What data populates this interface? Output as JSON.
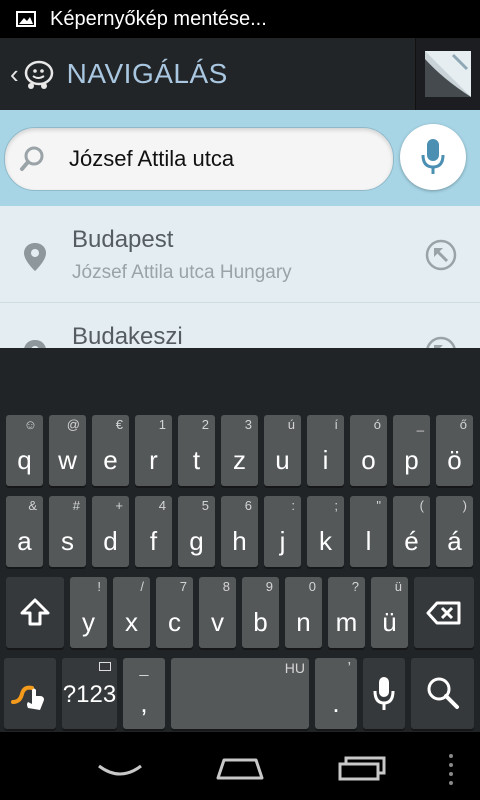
{
  "status_bar": {
    "text": "Képernyőkép mentése...",
    "icon": "screenshot-icon"
  },
  "action_bar": {
    "title": "NAVIGÁLÁS",
    "back_icon": "back-icon",
    "logo_icon": "waze-logo-icon",
    "menu_thumb": "map-thumbnail-icon"
  },
  "search": {
    "value": "József Attila utca",
    "icon": "search-icon",
    "mic_icon": "microphone-icon"
  },
  "results": [
    {
      "name": "Budapest",
      "detail": "József Attila utca Hungary",
      "icon": "location-pin-icon",
      "action_icon": "insert-suggestion-icon"
    },
    {
      "name": "Budakeszi",
      "detail": "",
      "icon": "location-pin-icon",
      "action_icon": "insert-suggestion-icon"
    }
  ],
  "keyboard": {
    "row1": [
      {
        "main": "q",
        "hint": "☺"
      },
      {
        "main": "w",
        "hint": "@"
      },
      {
        "main": "e",
        "hint": "€"
      },
      {
        "main": "r",
        "hint": "1"
      },
      {
        "main": "t",
        "hint": "2"
      },
      {
        "main": "z",
        "hint": "3"
      },
      {
        "main": "u",
        "hint": "ú"
      },
      {
        "main": "i",
        "hint": "í"
      },
      {
        "main": "o",
        "hint": "ó"
      },
      {
        "main": "p",
        "hint": "_"
      },
      {
        "main": "ö",
        "hint": "ő"
      }
    ],
    "row2": [
      {
        "main": "a",
        "hint": "&"
      },
      {
        "main": "s",
        "hint": "#"
      },
      {
        "main": "d",
        "hint": "+"
      },
      {
        "main": "f",
        "hint": "4"
      },
      {
        "main": "g",
        "hint": "5"
      },
      {
        "main": "h",
        "hint": "6"
      },
      {
        "main": "j",
        "hint": ":"
      },
      {
        "main": "k",
        "hint": ";"
      },
      {
        "main": "l",
        "hint": "\""
      },
      {
        "main": "é",
        "hint": "("
      },
      {
        "main": "á",
        "hint": ")"
      }
    ],
    "row3": [
      {
        "main": "y",
        "hint": "!"
      },
      {
        "main": "x",
        "hint": "/"
      },
      {
        "main": "c",
        "hint": "7"
      },
      {
        "main": "v",
        "hint": "8"
      },
      {
        "main": "b",
        "hint": "9"
      },
      {
        "main": "n",
        "hint": "0"
      },
      {
        "main": "m",
        "hint": "?"
      },
      {
        "main": "ü",
        "hint": "ü"
      }
    ],
    "symbols_label": "?123",
    "comma": {
      "main": ",",
      "hint": "_"
    },
    "space_hint": "HU",
    "period": {
      "main": ".",
      "hint": "’"
    },
    "icons": {
      "shift": "shift-icon",
      "backspace": "backspace-icon",
      "swype": "swype-icon",
      "mic": "microphone-icon",
      "search": "search-icon"
    }
  },
  "nav_bar": {
    "back": "nav-back-icon",
    "home": "nav-home-icon",
    "recents": "nav-recents-icon"
  }
}
